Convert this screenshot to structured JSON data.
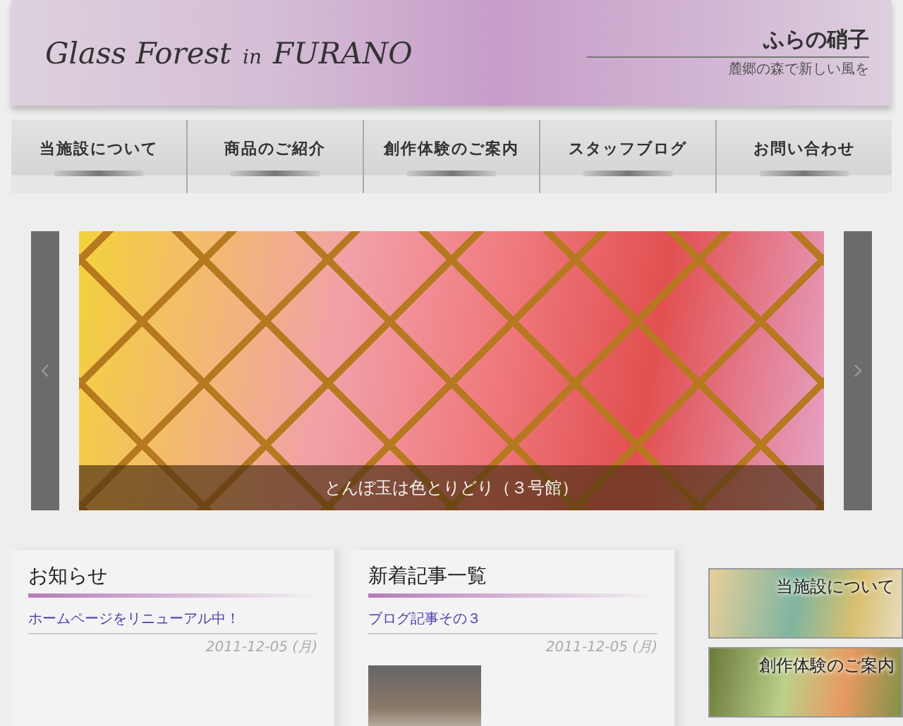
{
  "header": {
    "logo": "Glass Forest",
    "logo_in": "in",
    "logo_place": "FURANO",
    "site_name": "ふらの硝子",
    "tagline": "麓郷の森で新しい風を"
  },
  "nav": [
    {
      "label": "当施設について"
    },
    {
      "label": "商品のご紹介"
    },
    {
      "label": "創作体験のご案内"
    },
    {
      "label": "スタッフブログ"
    },
    {
      "label": "お問い合わせ"
    }
  ],
  "slider": {
    "caption": "とんぼ玉は色とりどり（３号館）"
  },
  "news": {
    "title": "お知らせ",
    "items": [
      {
        "link": "ホームページをリニューアル中！",
        "date": "2011-12-05 (月)"
      }
    ]
  },
  "blog": {
    "title": "新着記事一覧",
    "items": [
      {
        "link": "ブログ記事その３",
        "date": "2011-12-05 (月)"
      }
    ]
  },
  "banners": [
    {
      "label": "当施設について",
      "kind": "glass"
    },
    {
      "label": "創作体験のご案内",
      "kind": "workshop"
    }
  ]
}
